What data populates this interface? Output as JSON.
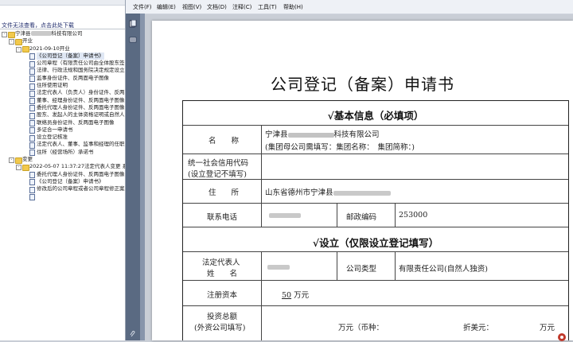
{
  "sidebar": {
    "notice": "文件无法查看，点击此处下载",
    "tree": [
      {
        "label": "宁津县",
        "suffix": "科技有限公司",
        "blur": 26,
        "indent": 0,
        "kind": "folder",
        "exp": "-"
      },
      {
        "label": "开业",
        "indent": 1,
        "kind": "folder",
        "exp": "-"
      },
      {
        "label": "2021-09-10开业",
        "indent": 2,
        "kind": "folder",
        "exp": "-"
      },
      {
        "label": "《公司登记（备案）申请书》",
        "indent": 3,
        "kind": "page",
        "selected": true
      },
      {
        "label": "公司章程（有限责任公司由全体股东签",
        "indent": 3,
        "kind": "page"
      },
      {
        "label": "法律、行政法规和国务院决定规定设立",
        "indent": 3,
        "kind": "page"
      },
      {
        "label": "监事身份证件、反两面电子图像",
        "indent": 3,
        "kind": "page"
      },
      {
        "label": "住所使用证明",
        "indent": 3,
        "kind": "page"
      },
      {
        "label": "法定代表人（负责人）身份证件、反两",
        "indent": 3,
        "kind": "page"
      },
      {
        "label": "董事、经理身份证件、反两面电子图像",
        "indent": 3,
        "kind": "page"
      },
      {
        "label": "委托代理人身份证件、反两面电子图像",
        "indent": 3,
        "kind": "page"
      },
      {
        "label": "股东、发起人的主体资格证明或自然人",
        "indent": 3,
        "kind": "page"
      },
      {
        "label": "联络员身份证件、反两面电子图像",
        "indent": 3,
        "kind": "page"
      },
      {
        "label": "多证合一申请书",
        "indent": 3,
        "kind": "page"
      },
      {
        "label": "设立登记核准",
        "indent": 3,
        "kind": "page"
      },
      {
        "label": "法定代表人、董事、监事和经理的任职",
        "indent": 3,
        "kind": "page"
      },
      {
        "label": "住所（经营场所）承诺书",
        "indent": 3,
        "kind": "page"
      },
      {
        "label": "变更",
        "indent": 1,
        "kind": "folder",
        "exp": "-"
      },
      {
        "label": "2022-05-07 11:37:27法定代表人变更 系",
        "indent": 2,
        "kind": "folder",
        "exp": "-"
      },
      {
        "label": "委托代理人身份证件、反两面电子图像",
        "indent": 3,
        "kind": "page"
      },
      {
        "label": "《公司登记（备案）申请书》",
        "indent": 3,
        "kind": "page"
      },
      {
        "label": "修改后的公司章程或者公司章程修正案",
        "indent": 3,
        "kind": "page"
      },
      {
        "label": "",
        "indent": 3,
        "kind": "page",
        "faded": true
      }
    ]
  },
  "menu": [
    "文件(F)",
    "编辑(E)",
    "视图(V)",
    "文档(D)",
    "注释(C)",
    "工具(T)",
    "帮助(H)"
  ],
  "document": {
    "title": "公司登记（备案）申请书",
    "section_basic": "√基本信息（必填项）",
    "label_name": "名　　称",
    "value_name_prefix": "宁津县",
    "value_name_suffix": "科技有限公司",
    "value_name_note": "(集团母公司需填写：集团名称：　集团简称：)",
    "label_credit_code_1": "统一社会信用代码",
    "label_credit_code_2": "(设立登记不填写)",
    "label_address": "住　　所",
    "value_address": "山东省德州市宁津县",
    "label_phone": "联系电话",
    "label_postcode": "邮政编码",
    "value_postcode": "253000",
    "section_setup": "√设立（仅限设立登记填写）",
    "label_legal_rep_1": "法定代表人",
    "label_legal_rep_2": "姓　　名",
    "label_company_type": "公司类型",
    "value_company_type": "有限责任公司(自然人独资)",
    "label_capital": "注册资本",
    "value_capital_amount": "50",
    "value_capital_unit": "万元",
    "label_investment_1": "投资总额",
    "label_investment_2": "(外资公司填写)",
    "value_investment_rmb": "万元（币种：",
    "value_investment_usd": "折美元：",
    "value_investment_end": "万元"
  }
}
